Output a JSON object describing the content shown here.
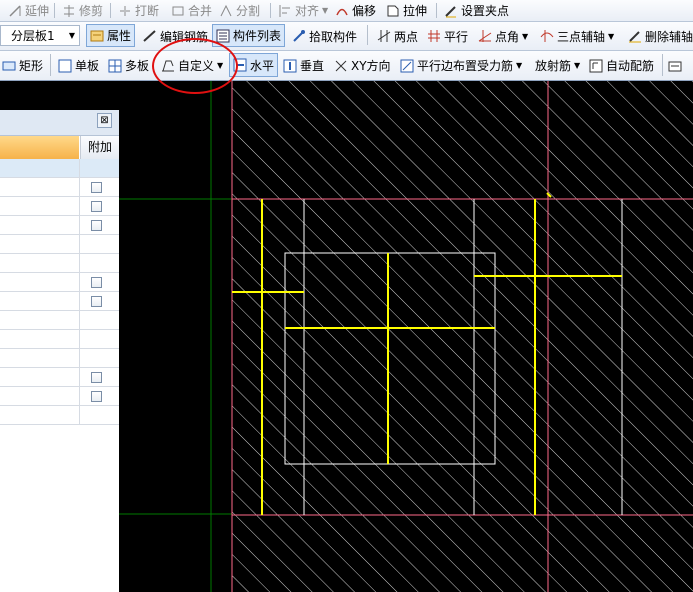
{
  "toolbar1": {
    "extend": "延伸",
    "trim": "修剪",
    "break": "打断",
    "merge": "合并",
    "split": "分割",
    "align": "对齐",
    "offset": "偏移",
    "stretch": "拉伸",
    "set_grip": "设置夹点"
  },
  "toolbar2": {
    "layer_select": "分层板1",
    "properties": "属性",
    "edit_rebar": "编辑钢筋",
    "component_list": "构件列表",
    "pick_component": "拾取构件",
    "two_points": "两点",
    "parallel": "平行",
    "point_angle": "点角",
    "three_point_axis": "三点辅轴",
    "delete_axis": "删除辅轴"
  },
  "toolbar3": {
    "rectangle": "矩形",
    "single_slab": "单板",
    "multi_slab": "多板",
    "custom": "自定义",
    "horizontal": "水平",
    "vertical": "垂直",
    "xy_direction": "XY方向",
    "parallel_edge": "平行边布置受力筋",
    "radial": "放射筋",
    "auto_rebar": "自动配筋"
  },
  "panel": {
    "close_glyph": "⊠",
    "column_attach": "附加",
    "rows": [
      {
        "checkbox": false
      },
      {
        "checkbox": true
      },
      {
        "checkbox": true
      },
      {
        "checkbox": true
      },
      {
        "checkbox": false
      },
      {
        "checkbox": false
      },
      {
        "checkbox": true
      },
      {
        "checkbox": true
      },
      {
        "checkbox": false
      },
      {
        "checkbox": false
      },
      {
        "checkbox": false
      },
      {
        "checkbox": true
      },
      {
        "checkbox": true
      },
      {
        "checkbox": false
      }
    ]
  },
  "colors": {
    "canvas_bg": "#000000",
    "hatch": "#d0d0d0",
    "slab_edge": "#ff6a8a",
    "rebar": "#ffff00",
    "guide": "#ffffff",
    "axis": "#007a00",
    "annotation": "#e01010"
  }
}
